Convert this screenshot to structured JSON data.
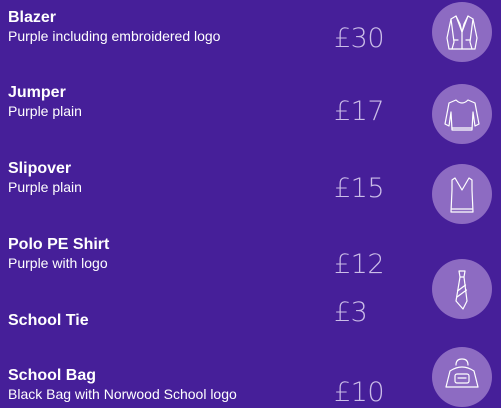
{
  "items": [
    {
      "name": "Blazer",
      "description": "Purple including embroidered logo",
      "price": "£30",
      "icon": "blazer-icon"
    },
    {
      "name": "Jumper",
      "description": "Purple plain",
      "price": "£17",
      "icon": "jumper-icon"
    },
    {
      "name": "Slipover",
      "description": "Purple plain",
      "price": "£15",
      "icon": "slipover-icon"
    },
    {
      "name": "Polo PE Shirt",
      "description": "Purple with logo",
      "price": "£12",
      "icon": ""
    },
    {
      "name": "School Tie",
      "description": "",
      "price": "£3",
      "icon": "tie-icon"
    },
    {
      "name": "School Bag",
      "description": "Black Bag with Norwood School logo",
      "price": "£10",
      "icon": "bag-icon"
    }
  ],
  "colors": {
    "background": "#461f99",
    "price_text": "#cbbde8",
    "icon_circle": "#8d6bc2",
    "text": "#ffffff"
  }
}
